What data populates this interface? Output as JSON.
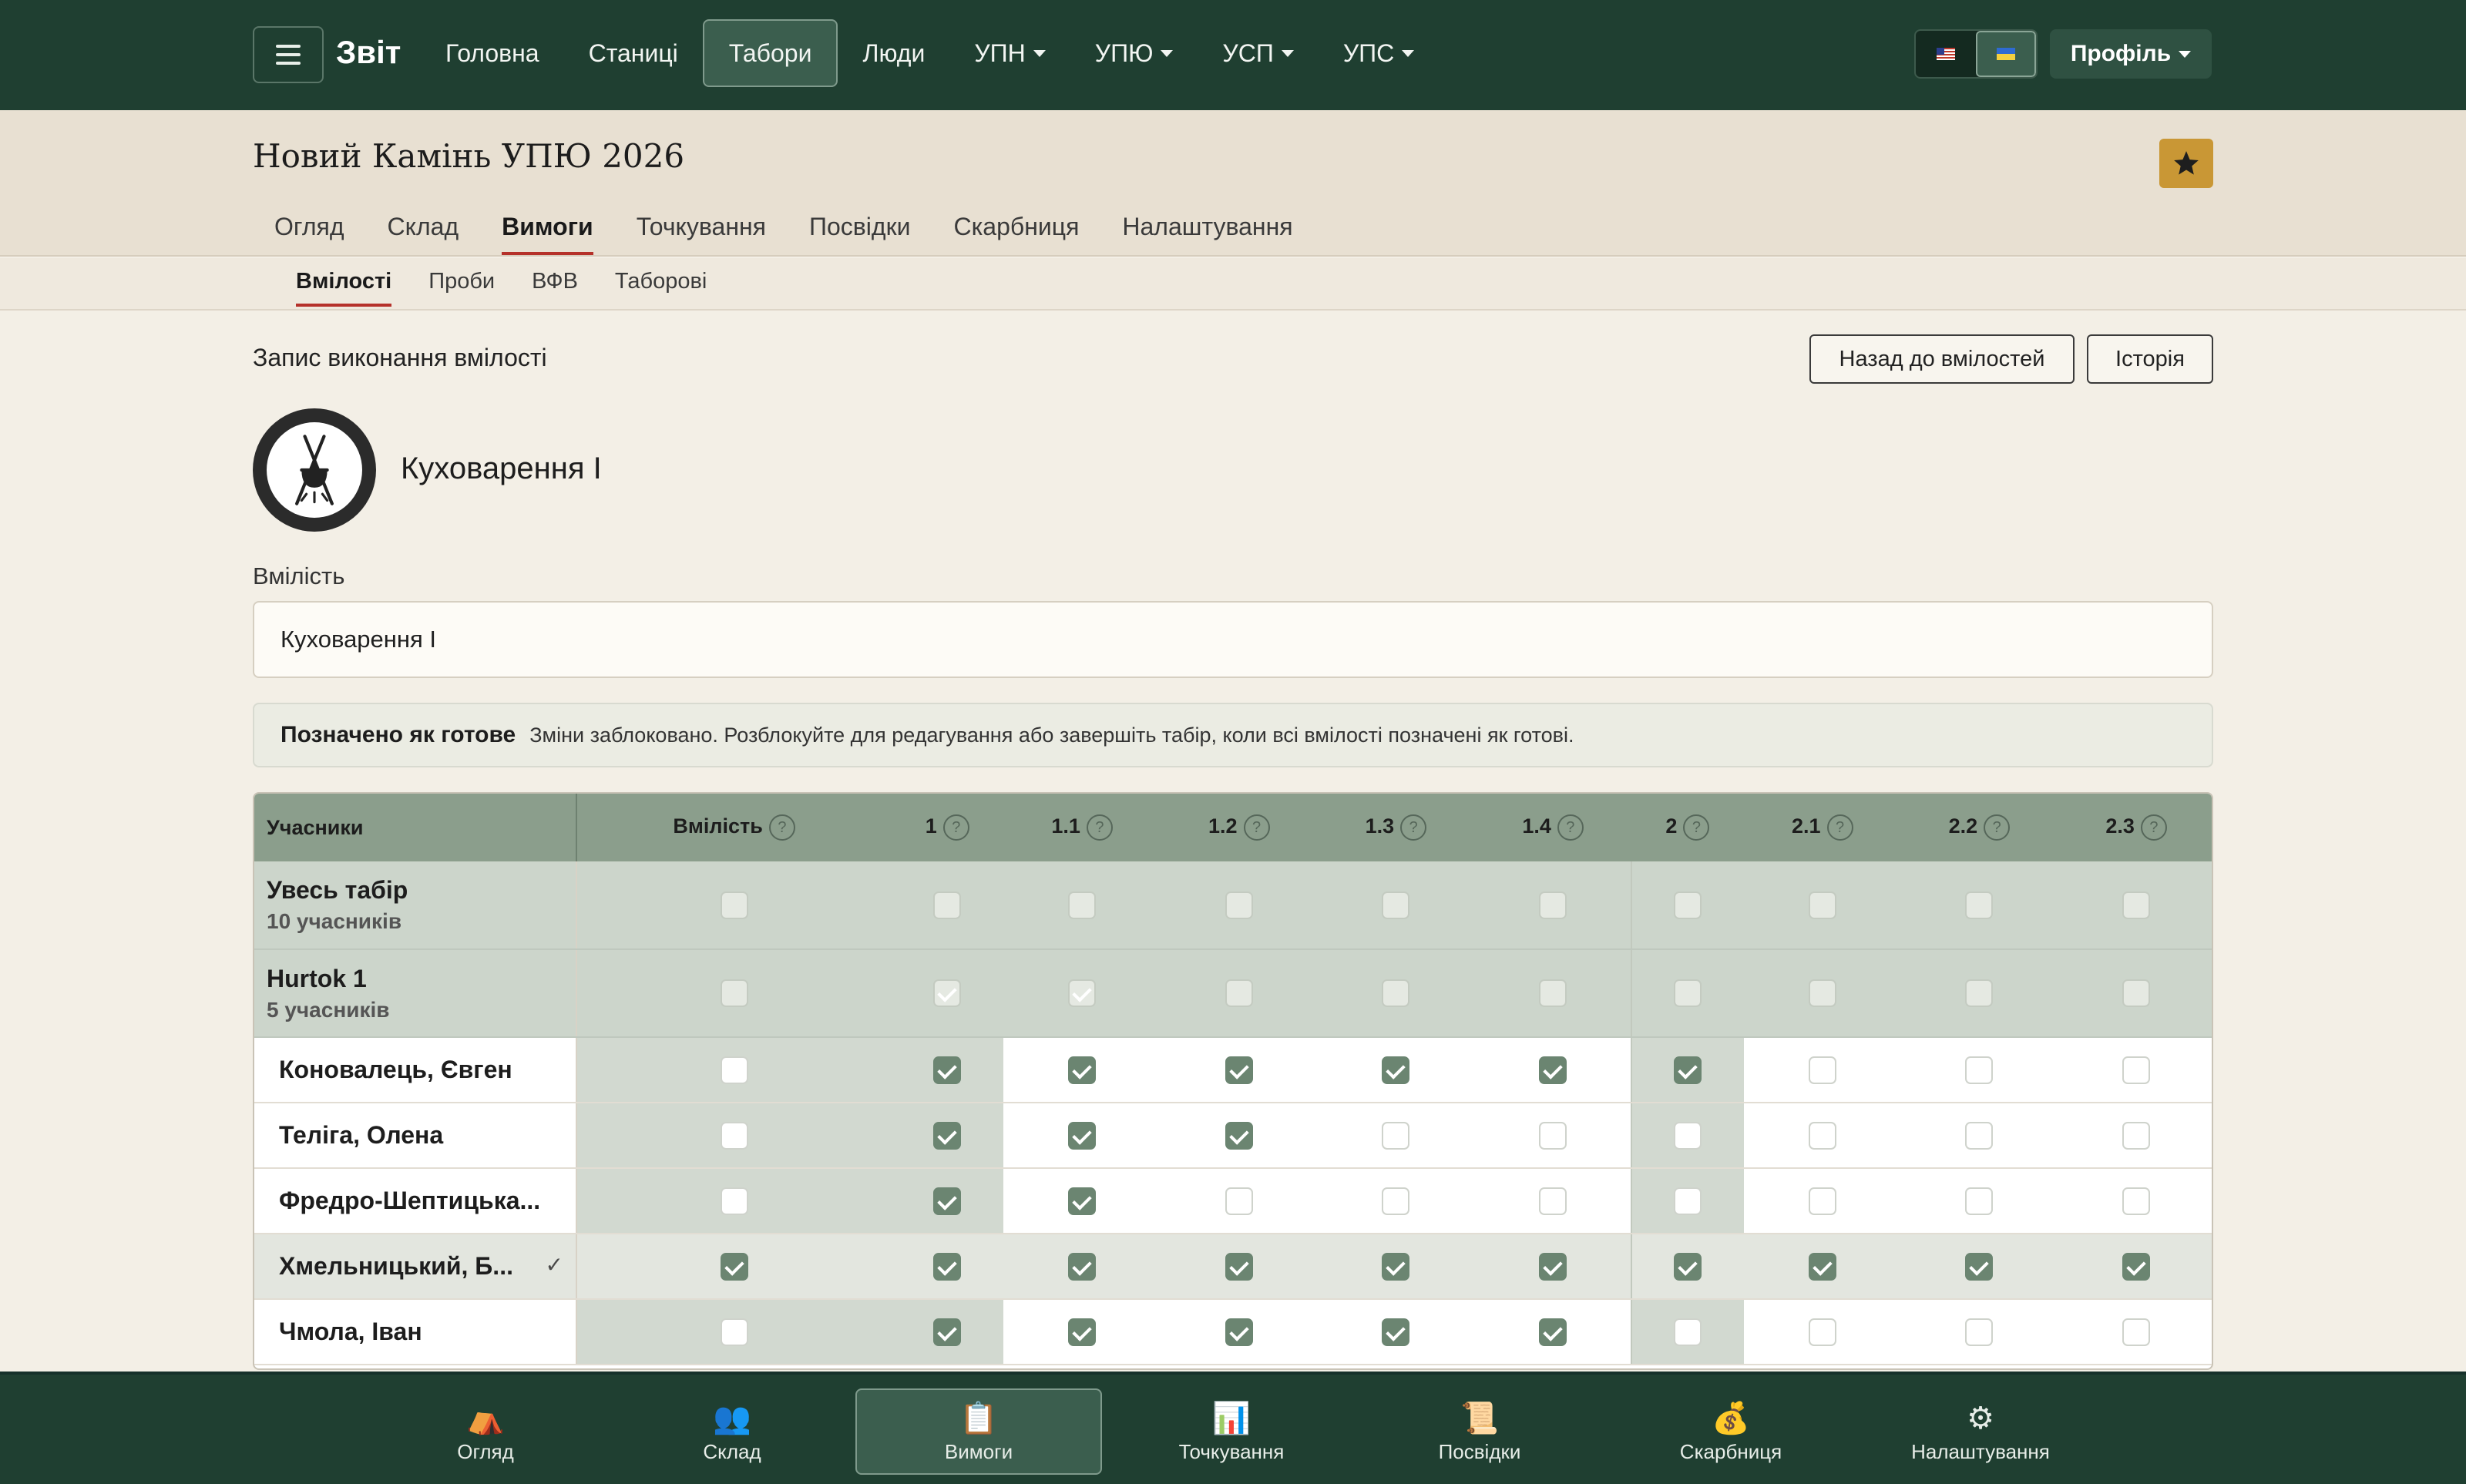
{
  "topbar": {
    "brand": "Звіт",
    "nav": [
      {
        "label": "Головна",
        "dropdown": false
      },
      {
        "label": "Станиці",
        "dropdown": false
      },
      {
        "label": "Табори",
        "dropdown": false,
        "active": true
      },
      {
        "label": "Люди",
        "dropdown": false
      },
      {
        "label": "УПН",
        "dropdown": true
      },
      {
        "label": "УПЮ",
        "dropdown": true
      },
      {
        "label": "УСП",
        "dropdown": true
      },
      {
        "label": "УПС",
        "dropdown": true
      }
    ],
    "languages": [
      "us-flag-icon",
      "ua-flag-icon"
    ],
    "profile_label": "Профіль"
  },
  "header": {
    "title": "Новий Камінь УПЮ 2026",
    "tabs": [
      "Огляд",
      "Склад",
      "Вимоги",
      "Точкування",
      "Посвідки",
      "Скарбниця",
      "Налаштування"
    ],
    "active_tab": "Вимоги",
    "subtabs": [
      "Вмілості",
      "Проби",
      "ВФВ",
      "Таборові"
    ],
    "active_subtab": "Вмілості"
  },
  "main": {
    "section_title": "Запис виконання вмілості",
    "back_button": "Назад до вмілостей",
    "history_button": "Історія",
    "skill_name": "Куховарення І",
    "field_label": "Вмілість",
    "field_value": "Куховарення І",
    "notice_title": "Позначено як готове",
    "notice_text": "Зміни заблоковано. Розблокуйте для редагування або завершіть табір, коли всі вмілості позначені як готові."
  },
  "table": {
    "first_header": "Учасники",
    "columns": [
      "Вмілість",
      "1",
      "1.1",
      "1.2",
      "1.3",
      "1.4",
      "2",
      "2.1",
      "2.2",
      "2.3"
    ],
    "rows": [
      {
        "type": "group",
        "name": "Увесь табір",
        "sub": "10 учасників",
        "checks": [
          0,
          0,
          0,
          0,
          0,
          0,
          0,
          0,
          0,
          0
        ]
      },
      {
        "type": "group",
        "name": "Hurtok 1",
        "sub": "5 учасників",
        "checks": [
          0,
          1,
          1,
          0,
          0,
          0,
          0,
          0,
          0,
          0
        ]
      },
      {
        "type": "person",
        "name": "Коновалець, Євген",
        "checks": [
          0,
          1,
          1,
          1,
          1,
          1,
          1,
          0,
          0,
          0
        ]
      },
      {
        "type": "person",
        "name": "Теліга, Олена",
        "checks": [
          0,
          1,
          1,
          1,
          0,
          0,
          0,
          0,
          0,
          0
        ]
      },
      {
        "type": "person",
        "name": "Фредро-Шептицька...",
        "checks": [
          0,
          1,
          1,
          0,
          0,
          0,
          0,
          0,
          0,
          0
        ]
      },
      {
        "type": "person",
        "name": "Хмельницький, Б...",
        "checks": [
          1,
          1,
          1,
          1,
          1,
          1,
          1,
          1,
          1,
          1
        ],
        "highlight": true,
        "row_mark": "✓"
      },
      {
        "type": "person",
        "name": "Чмола, Іван",
        "checks": [
          0,
          1,
          1,
          1,
          1,
          1,
          0,
          0,
          0,
          0
        ]
      }
    ]
  },
  "bottombar": [
    {
      "label": "Огляд",
      "icon": "tent-icon",
      "glyph": "⛺"
    },
    {
      "label": "Склад",
      "icon": "people-icon",
      "glyph": "👥"
    },
    {
      "label": "Вимоги",
      "icon": "clipboard-icon",
      "glyph": "📋",
      "active": true
    },
    {
      "label": "Точкування",
      "icon": "bar-chart-icon",
      "glyph": "📊"
    },
    {
      "label": "Посвідки",
      "icon": "scroll-icon",
      "glyph": "📜"
    },
    {
      "label": "Скарбниця",
      "icon": "money-bag-icon",
      "glyph": "💰"
    },
    {
      "label": "Налаштування",
      "icon": "gear-icon",
      "glyph": "⚙"
    }
  ],
  "colors": {
    "navbar": "#1f3f31",
    "accent_underline": "#b5312a",
    "checkbox_on": "#6b8571",
    "star_button": "#c99735"
  }
}
